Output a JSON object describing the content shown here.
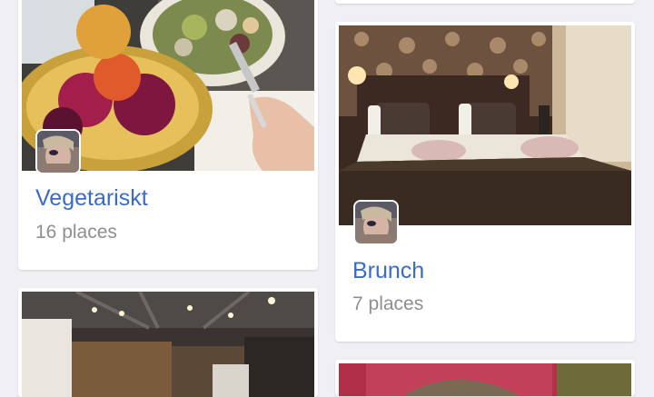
{
  "cards": [
    {
      "title": "Vegetariskt",
      "count": "16 places"
    },
    {
      "title": "Brunch",
      "count": "7 places"
    }
  ],
  "colors": {
    "background": "#efeff4",
    "card": "#ffffff",
    "title": "#3b6bc4",
    "subtitle": "#8e8e93"
  }
}
